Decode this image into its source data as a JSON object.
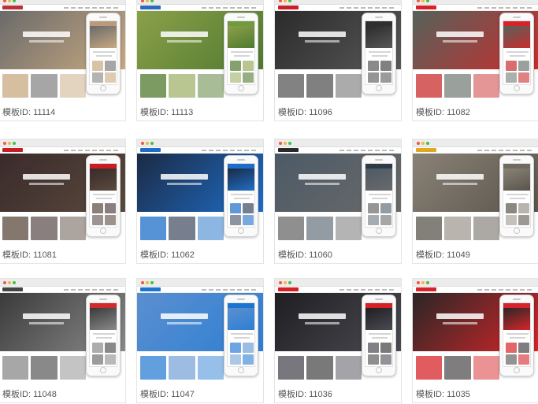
{
  "templates": [
    {
      "label": "模板ID: 11114",
      "colors": {
        "logo": "#b8323a",
        "banner": "#6a6a6a",
        "accent": "#c8a981",
        "phone": "#b89b7a"
      }
    },
    {
      "label": "模板ID: 11113",
      "colors": {
        "logo": "#2c6bb8",
        "banner": "#8ba04a",
        "accent": "#4f7a2f",
        "phone": "#6f9b3c"
      }
    },
    {
      "label": "模板ID: 11096",
      "colors": {
        "logo": "#c8202b",
        "banner": "#2b2b2b",
        "accent": "#585858",
        "phone": "#2f2f2f"
      }
    },
    {
      "label": "模板ID: 11082",
      "colors": {
        "logo": "#d7222a",
        "banner": "#56615a",
        "accent": "#c92e2e",
        "phone": "#d7222a"
      }
    },
    {
      "label": "模板ID: 11081",
      "colors": {
        "logo": "#c81d24",
        "banner": "#3a2a2a",
        "accent": "#5a4a3e",
        "phone": "#c81d24"
      }
    },
    {
      "label": "模板ID: 11062",
      "colors": {
        "logo": "#1e6ec8",
        "banner": "#1c2a44",
        "accent": "#1e6ec8",
        "phone": "#1e6ec8"
      }
    },
    {
      "label": "模板ID: 11060",
      "colors": {
        "logo": "#2a2a2a",
        "banner": "#4c5a66",
        "accent": "#6a6a6a",
        "phone": "#2c3a48"
      }
    },
    {
      "label": "模板ID: 11049",
      "colors": {
        "logo": "#e0a820",
        "banner": "#8a8276",
        "accent": "#5a544c",
        "phone": "#6f6a60"
      }
    },
    {
      "label": "模板ID: 11048",
      "colors": {
        "logo": "#444444",
        "banner": "#3a3a3a",
        "accent": "#8a8a8a",
        "phone": "#d12b2b"
      }
    },
    {
      "label": "模板ID: 11047",
      "colors": {
        "logo": "#1c74d0",
        "banner": "#5b8fcf",
        "accent": "#2d7fd4",
        "phone": "#1c74d0"
      }
    },
    {
      "label": "模板ID: 11036",
      "colors": {
        "logo": "#d81f26",
        "banner": "#1f1f22",
        "accent": "#4a4a52",
        "phone": "#d81f26"
      }
    },
    {
      "label": "模板ID: 11035",
      "colors": {
        "logo": "#d6252a",
        "banner": "#2a2626",
        "accent": "#d6252a",
        "phone": "#d6252a"
      }
    }
  ]
}
